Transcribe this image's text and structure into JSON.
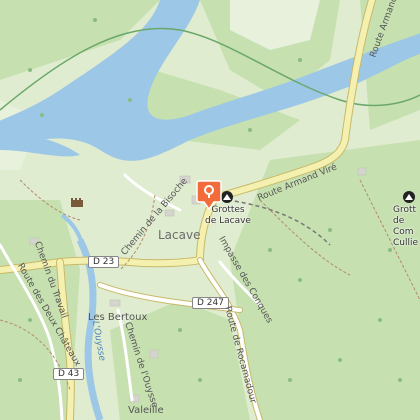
{
  "map": {
    "colors": {
      "land": "#dfeccf",
      "forest": "#c6e0b0",
      "water": "#9cc7e6",
      "road": "#f4f0b0",
      "marker": "#f26b3a"
    },
    "places": {
      "lacave": "Lacave",
      "les_bertoux": "Les Bertoux",
      "valeille": "Valeille"
    },
    "roads": {
      "d23": "D 23",
      "d247": "D 247",
      "d43": "D 43",
      "route_armand_vire_a": "Route Armand Viré",
      "route_armand_vire_b": "Route Armand",
      "chemin_bisoche": "Chemin de la Bisoche",
      "impasse_conques": "Impasse des Conques",
      "route_rocamadour": "Route de Rocamadour",
      "route_deux_chateaux": "Route des Deux Châteaux",
      "chemin_travail": "Chemin du Travail",
      "chemin_ouysse": "Chemin de l'Ouysse"
    },
    "water": {
      "ouysse": "L'Ouysse"
    },
    "pois": {
      "grottes_main_line1": "Grottes",
      "grottes_main_line2": "de Lacave",
      "grottes_right_line1": "Grott",
      "grottes_right_line2": "de Com",
      "grottes_right_line3": "Cullie"
    },
    "icons": {
      "castle": "castle-icon",
      "cave": "cave-icon",
      "marker": "location-pin-icon"
    }
  }
}
